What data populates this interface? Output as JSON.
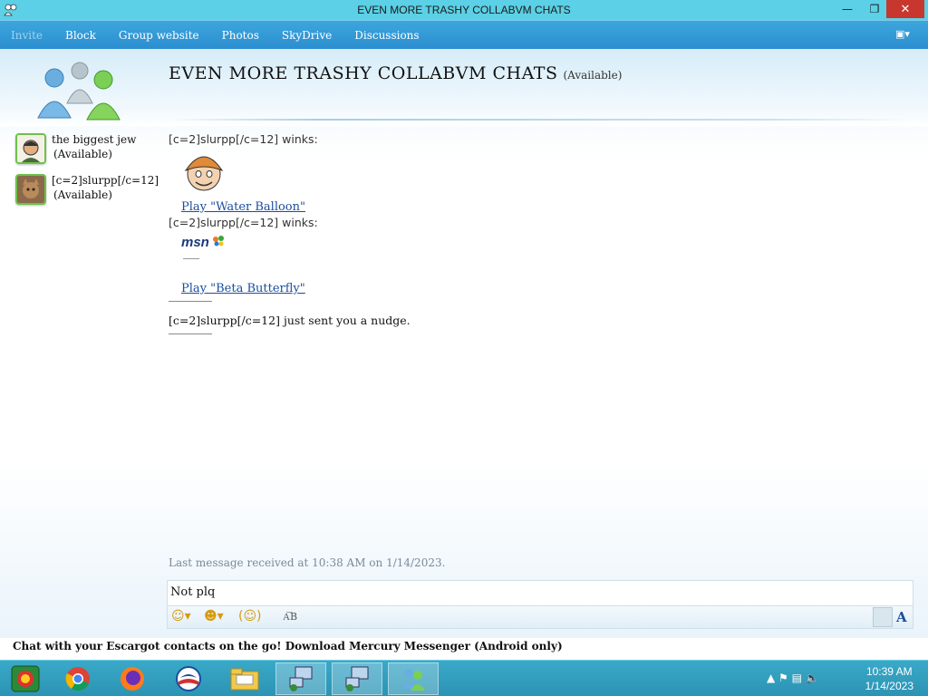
{
  "window": {
    "title": "EVEN MORE TRASHY COLLABVM CHATS",
    "minimize_glyph": "—",
    "maximize_glyph": "❐",
    "close_glyph": "✕"
  },
  "menu": {
    "items": [
      "Invite",
      "Block",
      "Group website",
      "Photos",
      "SkyDrive",
      "Discussions"
    ],
    "options_glyph": "▣▾"
  },
  "conversation": {
    "title": "EVEN MORE TRASHY COLLABVM CHATS",
    "status": "(Available)"
  },
  "participants": [
    {
      "name": "the biggest jew",
      "status": "(Available)"
    },
    {
      "name": "[c=2]slurpp[/c=12]",
      "status": "(Available)"
    }
  ],
  "messages": {
    "wink1_text": "[c=2]slurpp[/c=12] winks:",
    "wink1_link": "Play \"Water Balloon\"",
    "wink2_text": "[c=2]slurpp[/c=12] winks:",
    "wink2_logo": "msn",
    "wink2_link": "Play \"Beta Butterfly\"",
    "nudge_text": "[c=2]slurpp[/c=12] just sent you a nudge."
  },
  "last_message": "Last message received at 10:38 AM on 1/14/2023.",
  "input": {
    "value": "Not plq"
  },
  "input_toolbar": {
    "emoji_glyph": "☺▾",
    "wink_glyph": "☻▾",
    "nudge_glyph": "(☺)",
    "spell_label": "A͞B",
    "font_label": "A"
  },
  "ad_text": "Chat with your Escargot contacts on the go! Download Mercury Messenger (Android only)",
  "taskbar": {
    "time": "10:39 AM",
    "date": "1/14/2023",
    "tray_glyphs": "▲ ⚑ ▤ 🔈"
  },
  "colors": {
    "titlebar": "#5bd0e6",
    "menubar": "#3ca6dd",
    "link": "#1a4d9e",
    "close": "#c7372e",
    "taskbar": "#3aa9c8"
  }
}
